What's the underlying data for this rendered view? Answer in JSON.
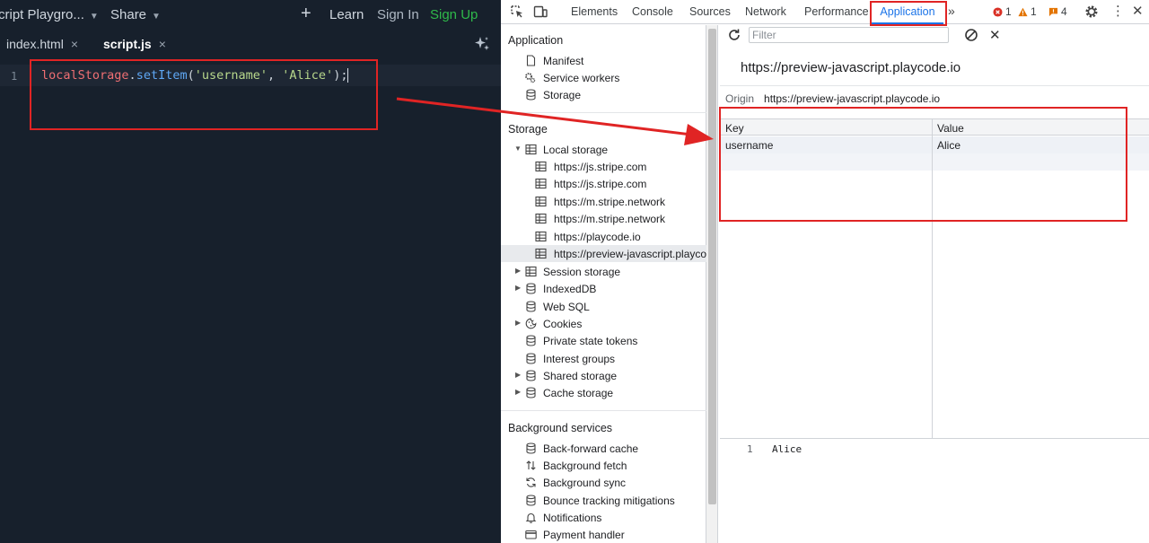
{
  "editor": {
    "app_title": "cript Playgro...",
    "share": "Share",
    "plus": "+",
    "learn": "Learn",
    "sign_in": "Sign In",
    "sign_up": "Sign Up",
    "tabs": [
      {
        "label": "index.html",
        "close": "×"
      },
      {
        "label": "script.js",
        "close": "×"
      }
    ],
    "line_number": "1",
    "code": {
      "obj": "localStorage",
      "dot": ".",
      "fn": "setItem",
      "open": "(",
      "arg1": "'username'",
      "comma": ", ",
      "arg2": "'Alice'",
      "close": ");"
    }
  },
  "devtools": {
    "tabs": {
      "elements": "Elements",
      "console": "Console",
      "sources": "Sources",
      "network": "Network",
      "performance": "Performance",
      "application": "Application",
      "more": "»"
    },
    "badges": {
      "errors": "1",
      "warnings": "1",
      "issues": "4"
    },
    "sidebar": {
      "application_head": "Application",
      "application_items": [
        "Manifest",
        "Service workers",
        "Storage"
      ],
      "storage_head": "Storage",
      "local_storage": "Local storage",
      "local_storage_items": [
        "https://js.stripe.com",
        "https://js.stripe.com",
        "https://m.stripe.network",
        "https://m.stripe.network",
        "https://playcode.io",
        "https://preview-javascript.playcode.io"
      ],
      "storage_items": [
        "Session storage",
        "IndexedDB",
        "Web SQL",
        "Cookies",
        "Private state tokens",
        "Interest groups",
        "Shared storage",
        "Cache storage"
      ],
      "background_head": "Background services",
      "background_items": [
        "Back-forward cache",
        "Background fetch",
        "Background sync",
        "Bounce tracking mitigations",
        "Notifications",
        "Payment handler"
      ]
    },
    "main": {
      "filter_placeholder": "Filter",
      "origin_title": "https://preview-javascript.playcode.io",
      "origin_label": "Origin",
      "origin_value": "https://preview-javascript.playcode.io",
      "columns": {
        "key": "Key",
        "value": "Value"
      },
      "rows": [
        {
          "key": "username",
          "value": "Alice"
        }
      ],
      "preview_line": "1",
      "preview_value": "Alice"
    }
  },
  "colors": {
    "highlight": "#e02424",
    "accent": "#1a73e8",
    "signup": "#2fb94a"
  }
}
